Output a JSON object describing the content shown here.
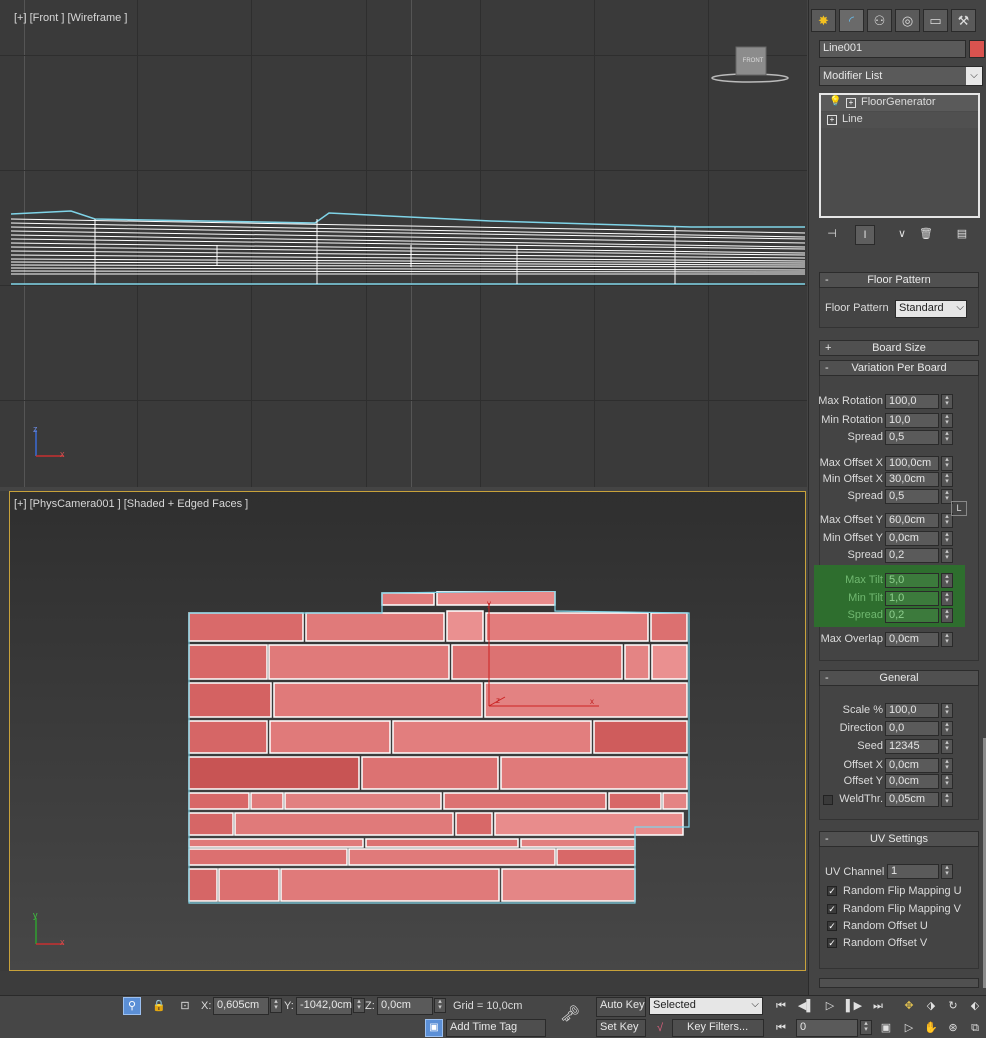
{
  "viewports": {
    "front_label": "[+] [Front ] [Wireframe ]",
    "viewcube_label": "FRONT",
    "camera_label": "[+] [PhysCamera001 ] [Shaded + Edged Faces ]",
    "axis_z": "z",
    "axis_x": "x",
    "axis_y": "y"
  },
  "panel": {
    "tab_icons": [
      "create-icon",
      "modify-icon",
      "hierarchy-icon",
      "motion-icon",
      "display-icon",
      "utilities-icon"
    ],
    "object_name": "Line001",
    "object_color": "#d9534f",
    "modifier_list": "Modifier List",
    "stack": [
      "FloorGenerator",
      "Line"
    ],
    "floor_pattern": {
      "title": "Floor Pattern",
      "sign": "-",
      "label": "Floor Pattern",
      "value": "Standard"
    },
    "board_size": {
      "title": "Board Size",
      "sign": "+"
    },
    "variation": {
      "title": "Variation Per Board",
      "sign": "-",
      "rows": [
        {
          "label": "Max Rotation",
          "value": "100,0"
        },
        {
          "label": "Min Rotation",
          "value": "10,0"
        },
        {
          "label": "Spread",
          "value": "0,5"
        },
        {
          "label": "Max Offset X",
          "value": "100,0cm"
        },
        {
          "label": "Min Offset X",
          "value": "30,0cm"
        },
        {
          "label": "Spread",
          "value": "0,5"
        },
        {
          "label": "Max Offset Y",
          "value": "60,0cm"
        },
        {
          "label": "Min Offset Y",
          "value": "0,0cm"
        },
        {
          "label": "Spread",
          "value": "0,2"
        },
        {
          "label": "Max Tilt",
          "value": "5,0"
        },
        {
          "label": "Min Tilt",
          "value": "1,0"
        },
        {
          "label": "Spread",
          "value": "0,2"
        },
        {
          "label": "Max Overlap",
          "value": "0,0cm"
        }
      ],
      "lock_label": "L"
    },
    "general": {
      "title": "General",
      "sign": "-",
      "rows": [
        {
          "label": "Scale %",
          "value": "100,0"
        },
        {
          "label": "Direction",
          "value": "0,0"
        },
        {
          "label": "Seed",
          "value": "12345"
        },
        {
          "label": "Offset X",
          "value": "0,0cm"
        },
        {
          "label": "Offset Y",
          "value": "0,0cm"
        },
        {
          "label": "WeldThr.",
          "value": "0,05cm"
        }
      ]
    },
    "uv": {
      "title": "UV Settings",
      "sign": "-",
      "channel_label": "UV Channel",
      "channel_value": "1",
      "checks": [
        "Random Flip Mapping U",
        "Random Flip Mapping V",
        "Random Offset U",
        "Random Offset V"
      ]
    }
  },
  "bottom": {
    "x_label": "X:",
    "x_value": "0,605cm",
    "y_label": "Y:",
    "y_value": "-1042,0cm",
    "z_label": "Z:",
    "z_value": "0,0cm",
    "grid": "Grid = 10,0cm",
    "add_time_tag": "Add Time Tag",
    "auto_key": "Auto Key",
    "set_key": "Set Key",
    "selected": "Selected",
    "key_filters": "Key Filters...",
    "frame": "0"
  }
}
